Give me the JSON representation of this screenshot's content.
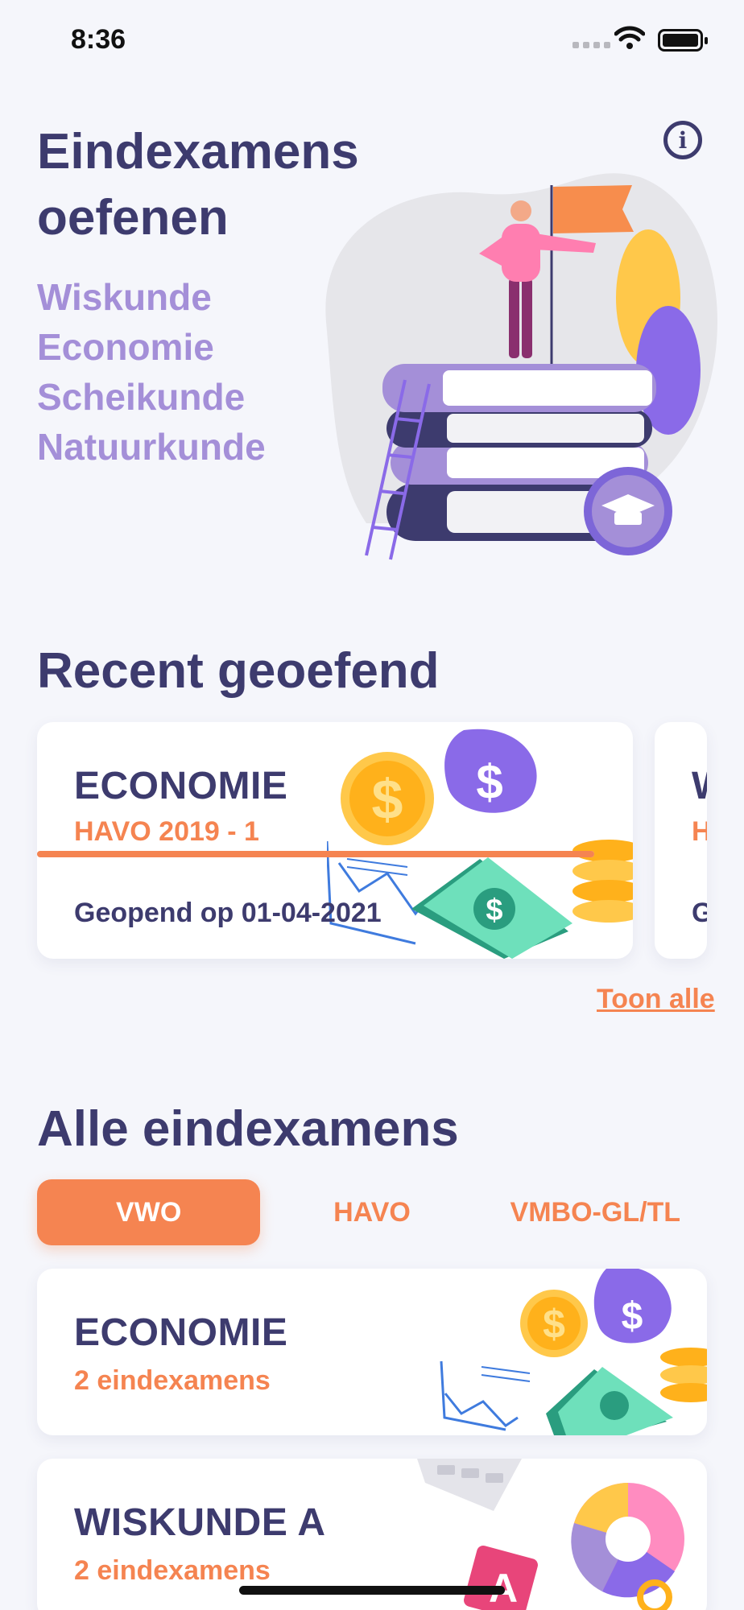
{
  "status_bar": {
    "time": "8:36"
  },
  "hero": {
    "title": "Eindexamens oefenen",
    "subjects": [
      "Wiskunde",
      "Economie",
      "Scheikunde",
      "Natuurkunde"
    ]
  },
  "recent": {
    "title": "Recent geoefend",
    "cards": [
      {
        "subject": "ECONOMIE",
        "exam": "HAVO 2019 - 1",
        "opened": "Geopend op 01-04-2021",
        "progress": 1.0
      },
      {
        "subject": "W",
        "exam": "H",
        "opened": "G"
      }
    ],
    "show_all": "Toon alle"
  },
  "all_exams": {
    "title": "Alle eindexamens",
    "tabs": [
      "VWO",
      "HAVO",
      "VMBO-GL/TL"
    ],
    "active_tab": "VWO",
    "cards": [
      {
        "subject": "ECONOMIE",
        "count": "2 eindexamens"
      },
      {
        "subject": "WISKUNDE A",
        "count": "2 eindexamens"
      }
    ]
  },
  "colors": {
    "accent": "#f58451",
    "primary": "#3d3b6e",
    "lavender": "#a48fd8",
    "background": "#f5f6fb"
  }
}
